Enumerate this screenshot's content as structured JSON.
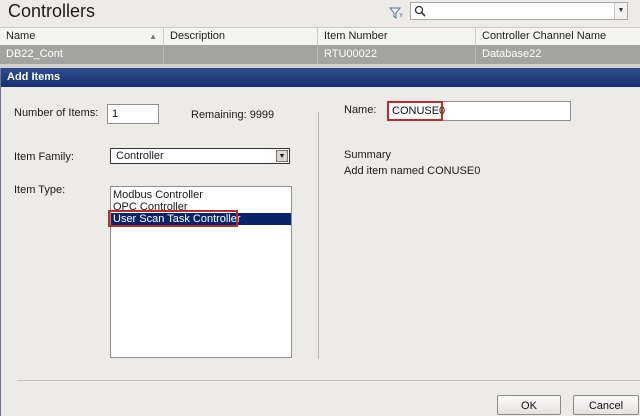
{
  "page": {
    "title": "Controllers"
  },
  "search": {
    "value": "",
    "placeholder": ""
  },
  "grid": {
    "columns": [
      "Name",
      "Description",
      "Item Number",
      "Controller Channel Name"
    ],
    "rows": [
      {
        "name": "DB22_Cont",
        "description": "",
        "item_number": "RTU00022",
        "channel": "Database22"
      }
    ]
  },
  "dialog": {
    "title": "Add Items",
    "number_of_items_label": "Number of Items:",
    "number_of_items_value": "1",
    "remaining_label": "Remaining: 9999",
    "item_family_label": "Item Family:",
    "item_family_value": "Controller",
    "item_type_label": "Item Type:",
    "item_types": [
      "Modbus Controller",
      "OPC Controller",
      "User Scan Task Controller"
    ],
    "selected_item_type": "User Scan Task Controller",
    "name_label": "Name:",
    "name_value": "CONUSE0",
    "summary_label": "Summary",
    "summary_text": "Add item named CONUSE0",
    "ok_label": "OK",
    "cancel_label": "Cancel"
  },
  "colors": {
    "title_bar": "#163170",
    "selection": "#0a246a",
    "highlight": "#c22a2a",
    "grid_row": "#a3a3a1"
  },
  "icons": {
    "filter": "filter-icon",
    "search": "search-icon",
    "dropdown": "chevron-down-icon"
  }
}
